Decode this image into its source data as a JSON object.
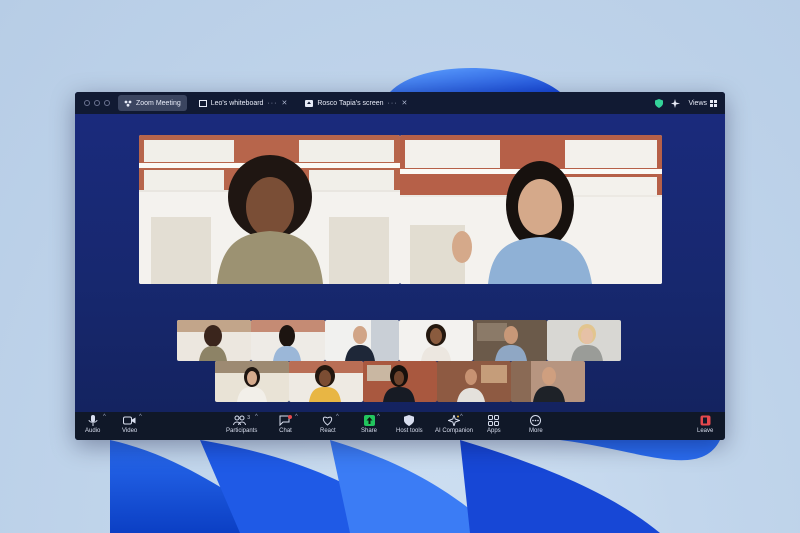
{
  "tabs": [
    {
      "label": "Zoom Meeting",
      "icon": "zoom-logo-icon"
    },
    {
      "label": "Leo's whiteboard",
      "icon": "whiteboard-icon"
    },
    {
      "label": "Rosco Tapia's screen",
      "icon": "share-screen-icon"
    }
  ],
  "header": {
    "views_label": "Views"
  },
  "toolbar": {
    "audio": "Audio",
    "video": "Video",
    "participants": "Participants",
    "participants_count": "3",
    "chat": "Chat",
    "react": "React",
    "share": "Share",
    "host_tools": "Host tools",
    "ai_companion": "AI Companion",
    "apps": "Apps",
    "more": "More",
    "leave": "Leave"
  },
  "colors": {
    "window_bg": "#1a2a7a",
    "toolbar_bg": "#101828",
    "share_green": "#22c55e",
    "leave_red": "#e5484d",
    "shield_green": "#34d399"
  }
}
